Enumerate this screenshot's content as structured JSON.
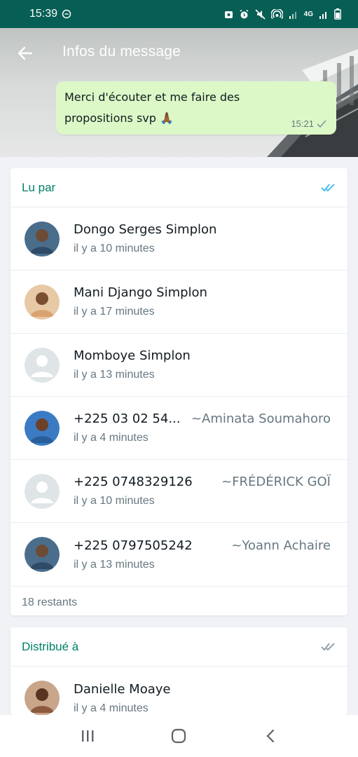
{
  "status_bar": {
    "time": "15:39",
    "network": "4G",
    "icons": [
      "whatsapp-notification-icon",
      "alarm-icon",
      "mute-icon",
      "hotspot-icon",
      "signal-icon",
      "battery-icon"
    ]
  },
  "header": {
    "title": "Infos du message",
    "back_icon": "arrow-left-icon"
  },
  "message": {
    "text": "Merci d'écouter et me faire des propositions svp 🙏🏾",
    "time": "15:21",
    "status_icon": "single-check-icon"
  },
  "read_section": {
    "title": "Lu par",
    "tick_color": "#34b7f1",
    "entries": [
      {
        "name": "Dongo Serges Simplon",
        "pushname": "",
        "time": "il y a 10 minutes",
        "avatar": "photo"
      },
      {
        "name": "Mani Django Simplon",
        "pushname": "",
        "time": "il y a 17 minutes",
        "avatar": "photo"
      },
      {
        "name": "Momboye Simplon",
        "pushname": "",
        "time": "il y a 13 minutes",
        "avatar": "default"
      },
      {
        "name": "+225 03 02 54...",
        "pushname": "~Aminata Soumahoro",
        "time": "il y a 4 minutes",
        "avatar": "photo"
      },
      {
        "name": "+225 0748329126",
        "pushname": "~FRÉDÉRICK GOÏ",
        "time": "il y a 10 minutes",
        "avatar": "default"
      },
      {
        "name": "+225 0797505242",
        "pushname": "~Yoann Achaire",
        "time": "il y a 13 minutes",
        "avatar": "photo"
      }
    ],
    "remaining": "18 restants"
  },
  "delivered_section": {
    "title": "Distribué à",
    "tick_color": "#8696a0",
    "entries": [
      {
        "name": "Danielle Moaye",
        "pushname": "",
        "time": "il y a 4 minutes",
        "avatar": "photo"
      }
    ]
  },
  "nav_bar": {
    "icons": [
      "recent-apps-icon",
      "home-icon",
      "back-icon"
    ]
  },
  "colors": {
    "accent": "#008069",
    "status_bar": "#075e54",
    "bubble": "#dcf8c6"
  }
}
